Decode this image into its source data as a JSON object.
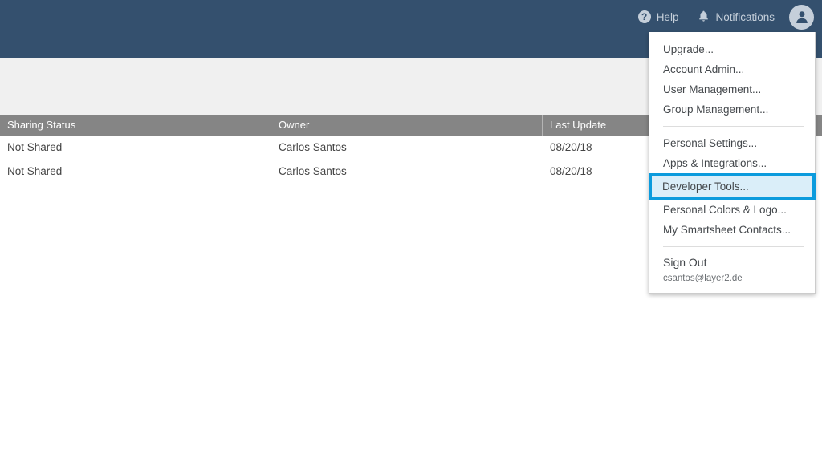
{
  "appbar": {
    "background_color": "#34506e",
    "items": [
      {
        "name": "help",
        "label": "Help",
        "icon": "help-circle-icon"
      },
      {
        "name": "notifications",
        "label": "Notifications",
        "icon": "bell-icon"
      }
    ],
    "help_glyph": "?",
    "avatar_icon": "user-avatar-icon"
  },
  "table": {
    "header_background": "#858585",
    "columns": [
      {
        "key": "sharing_status",
        "label": "Sharing Status"
      },
      {
        "key": "owner",
        "label": "Owner"
      },
      {
        "key": "last_update",
        "label": "Last Update"
      }
    ],
    "rows": [
      {
        "sharing_status": "Not Shared",
        "owner": "Carlos Santos",
        "last_update": "08/20/18"
      },
      {
        "sharing_status": "Not Shared",
        "owner": "Carlos Santos",
        "last_update": "08/20/18"
      }
    ]
  },
  "account_menu": {
    "highlight_color": "#0b9bdd",
    "highlight_fill": "#daeef9",
    "group_account": [
      {
        "id": "upgrade",
        "label": "Upgrade..."
      },
      {
        "id": "account-admin",
        "label": "Account Admin..."
      },
      {
        "id": "user-management",
        "label": "User Management..."
      },
      {
        "id": "group-management",
        "label": "Group Management..."
      }
    ],
    "group_personal": [
      {
        "id": "personal-settings",
        "label": "Personal Settings...",
        "highlighted": false
      },
      {
        "id": "apps-integrations",
        "label": "Apps & Integrations...",
        "highlighted": false
      },
      {
        "id": "developer-tools",
        "label": "Developer Tools...",
        "highlighted": true
      },
      {
        "id": "personal-colors-logo",
        "label": "Personal Colors & Logo...",
        "highlighted": false
      },
      {
        "id": "my-smartsheet-contacts",
        "label": "My Smartsheet Contacts...",
        "highlighted": false
      }
    ],
    "sign_out_label": "Sign Out",
    "account_email": "csantos@layer2.de"
  }
}
